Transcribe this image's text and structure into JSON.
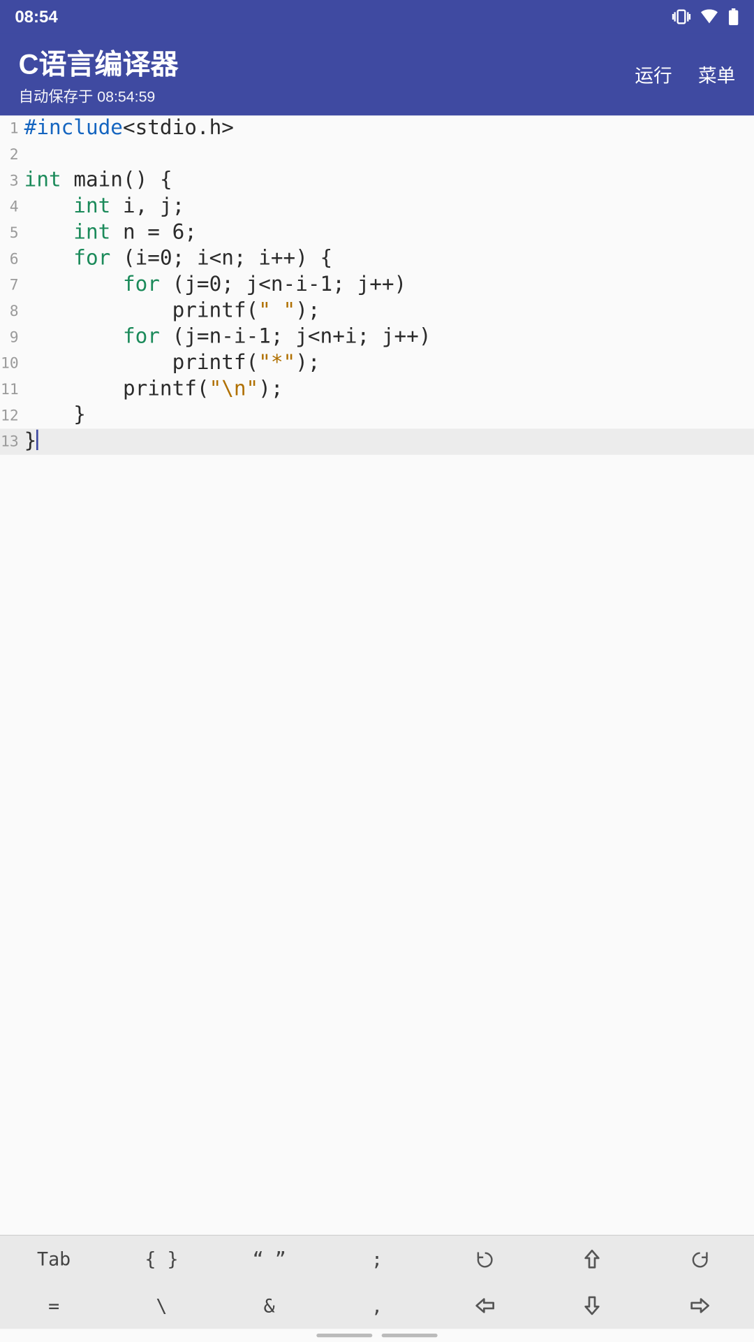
{
  "status_bar": {
    "time": "08:54",
    "icons": [
      "vibrate",
      "wifi",
      "battery"
    ]
  },
  "app_bar": {
    "title": "C语言编译器",
    "subtitle": "自动保存于 08:54:59",
    "actions": {
      "run": "运行",
      "menu": "菜单"
    }
  },
  "editor": {
    "active_line": 13,
    "cursor_after_last": true,
    "lines": [
      {
        "n": 1,
        "tokens": [
          [
            "pre",
            "#include"
          ],
          [
            "txt",
            "<stdio.h>"
          ]
        ]
      },
      {
        "n": 2,
        "tokens": []
      },
      {
        "n": 3,
        "tokens": [
          [
            "kw",
            "int"
          ],
          [
            "txt",
            " main() {"
          ]
        ]
      },
      {
        "n": 4,
        "tokens": [
          [
            "txt",
            "    "
          ],
          [
            "kw",
            "int"
          ],
          [
            "txt",
            " i, j;"
          ]
        ]
      },
      {
        "n": 5,
        "tokens": [
          [
            "txt",
            "    "
          ],
          [
            "kw",
            "int"
          ],
          [
            "txt",
            " n = "
          ],
          [
            "num",
            "6"
          ],
          [
            "txt",
            ";"
          ]
        ]
      },
      {
        "n": 6,
        "tokens": [
          [
            "txt",
            "    "
          ],
          [
            "kw",
            "for"
          ],
          [
            "txt",
            " (i="
          ],
          [
            "num",
            "0"
          ],
          [
            "txt",
            "; i<n; i++) {"
          ]
        ]
      },
      {
        "n": 7,
        "tokens": [
          [
            "txt",
            "        "
          ],
          [
            "kw",
            "for"
          ],
          [
            "txt",
            " (j="
          ],
          [
            "num",
            "0"
          ],
          [
            "txt",
            "; j<n-i-"
          ],
          [
            "num",
            "1"
          ],
          [
            "txt",
            "; j++)"
          ]
        ]
      },
      {
        "n": 8,
        "tokens": [
          [
            "txt",
            "            printf("
          ],
          [
            "str",
            "\" \""
          ],
          [
            "txt",
            ");"
          ]
        ]
      },
      {
        "n": 9,
        "tokens": [
          [
            "txt",
            "        "
          ],
          [
            "kw",
            "for"
          ],
          [
            "txt",
            " (j=n-i-"
          ],
          [
            "num",
            "1"
          ],
          [
            "txt",
            "; j<n+i; j++)"
          ]
        ]
      },
      {
        "n": 10,
        "tokens": [
          [
            "txt",
            "            printf("
          ],
          [
            "str",
            "\"*\""
          ],
          [
            "txt",
            ");"
          ]
        ]
      },
      {
        "n": 11,
        "tokens": [
          [
            "txt",
            "        printf("
          ],
          [
            "str",
            "\"\\n\""
          ],
          [
            "txt",
            ");"
          ]
        ]
      },
      {
        "n": 12,
        "tokens": [
          [
            "txt",
            "    }"
          ]
        ]
      },
      {
        "n": 13,
        "tokens": [
          [
            "txt",
            "}"
          ]
        ]
      }
    ]
  },
  "toolbar": {
    "rows": [
      [
        {
          "kind": "text",
          "label": "Tab",
          "name": "key-tab"
        },
        {
          "kind": "text",
          "label": "{ }",
          "name": "key-braces"
        },
        {
          "kind": "text",
          "label": "“ ”",
          "name": "key-quotes"
        },
        {
          "kind": "text",
          "label": ";",
          "name": "key-semicolon"
        },
        {
          "kind": "icon",
          "icon": "undo",
          "name": "key-undo"
        },
        {
          "kind": "icon",
          "icon": "up",
          "name": "key-up"
        },
        {
          "kind": "icon",
          "icon": "redo",
          "name": "key-redo"
        }
      ],
      [
        {
          "kind": "text",
          "label": "=",
          "name": "key-equals"
        },
        {
          "kind": "text",
          "label": "\\",
          "name": "key-backslash"
        },
        {
          "kind": "text",
          "label": "&",
          "name": "key-ampersand"
        },
        {
          "kind": "text",
          "label": ",",
          "name": "key-comma"
        },
        {
          "kind": "icon",
          "icon": "left",
          "name": "key-left"
        },
        {
          "kind": "icon",
          "icon": "down",
          "name": "key-down"
        },
        {
          "kind": "icon",
          "icon": "right",
          "name": "key-right"
        }
      ]
    ]
  }
}
